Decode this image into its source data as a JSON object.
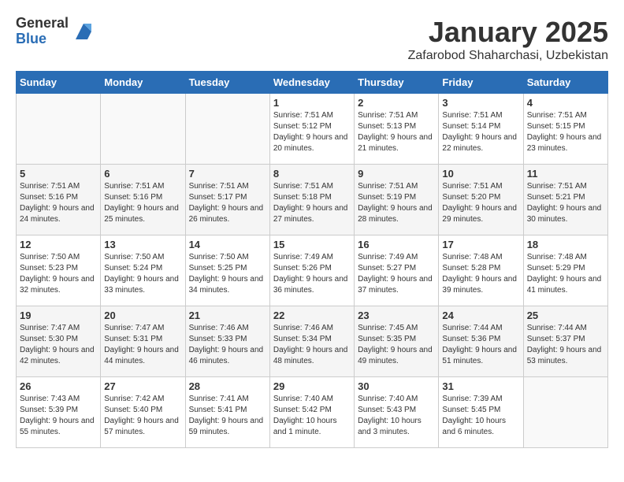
{
  "header": {
    "logo_general": "General",
    "logo_blue": "Blue",
    "month_title": "January 2025",
    "location": "Zafarobod Shaharchasi, Uzbekistan"
  },
  "days_of_week": [
    "Sunday",
    "Monday",
    "Tuesday",
    "Wednesday",
    "Thursday",
    "Friday",
    "Saturday"
  ],
  "weeks": [
    [
      {
        "day": "",
        "sunrise": "",
        "sunset": "",
        "daylight": ""
      },
      {
        "day": "",
        "sunrise": "",
        "sunset": "",
        "daylight": ""
      },
      {
        "day": "",
        "sunrise": "",
        "sunset": "",
        "daylight": ""
      },
      {
        "day": "1",
        "sunrise": "7:51 AM",
        "sunset": "5:12 PM",
        "daylight": "9 hours and 20 minutes."
      },
      {
        "day": "2",
        "sunrise": "7:51 AM",
        "sunset": "5:13 PM",
        "daylight": "9 hours and 21 minutes."
      },
      {
        "day": "3",
        "sunrise": "7:51 AM",
        "sunset": "5:14 PM",
        "daylight": "9 hours and 22 minutes."
      },
      {
        "day": "4",
        "sunrise": "7:51 AM",
        "sunset": "5:15 PM",
        "daylight": "9 hours and 23 minutes."
      }
    ],
    [
      {
        "day": "5",
        "sunrise": "7:51 AM",
        "sunset": "5:16 PM",
        "daylight": "9 hours and 24 minutes."
      },
      {
        "day": "6",
        "sunrise": "7:51 AM",
        "sunset": "5:16 PM",
        "daylight": "9 hours and 25 minutes."
      },
      {
        "day": "7",
        "sunrise": "7:51 AM",
        "sunset": "5:17 PM",
        "daylight": "9 hours and 26 minutes."
      },
      {
        "day": "8",
        "sunrise": "7:51 AM",
        "sunset": "5:18 PM",
        "daylight": "9 hours and 27 minutes."
      },
      {
        "day": "9",
        "sunrise": "7:51 AM",
        "sunset": "5:19 PM",
        "daylight": "9 hours and 28 minutes."
      },
      {
        "day": "10",
        "sunrise": "7:51 AM",
        "sunset": "5:20 PM",
        "daylight": "9 hours and 29 minutes."
      },
      {
        "day": "11",
        "sunrise": "7:51 AM",
        "sunset": "5:21 PM",
        "daylight": "9 hours and 30 minutes."
      }
    ],
    [
      {
        "day": "12",
        "sunrise": "7:50 AM",
        "sunset": "5:23 PM",
        "daylight": "9 hours and 32 minutes."
      },
      {
        "day": "13",
        "sunrise": "7:50 AM",
        "sunset": "5:24 PM",
        "daylight": "9 hours and 33 minutes."
      },
      {
        "day": "14",
        "sunrise": "7:50 AM",
        "sunset": "5:25 PM",
        "daylight": "9 hours and 34 minutes."
      },
      {
        "day": "15",
        "sunrise": "7:49 AM",
        "sunset": "5:26 PM",
        "daylight": "9 hours and 36 minutes."
      },
      {
        "day": "16",
        "sunrise": "7:49 AM",
        "sunset": "5:27 PM",
        "daylight": "9 hours and 37 minutes."
      },
      {
        "day": "17",
        "sunrise": "7:48 AM",
        "sunset": "5:28 PM",
        "daylight": "9 hours and 39 minutes."
      },
      {
        "day": "18",
        "sunrise": "7:48 AM",
        "sunset": "5:29 PM",
        "daylight": "9 hours and 41 minutes."
      }
    ],
    [
      {
        "day": "19",
        "sunrise": "7:47 AM",
        "sunset": "5:30 PM",
        "daylight": "9 hours and 42 minutes."
      },
      {
        "day": "20",
        "sunrise": "7:47 AM",
        "sunset": "5:31 PM",
        "daylight": "9 hours and 44 minutes."
      },
      {
        "day": "21",
        "sunrise": "7:46 AM",
        "sunset": "5:33 PM",
        "daylight": "9 hours and 46 minutes."
      },
      {
        "day": "22",
        "sunrise": "7:46 AM",
        "sunset": "5:34 PM",
        "daylight": "9 hours and 48 minutes."
      },
      {
        "day": "23",
        "sunrise": "7:45 AM",
        "sunset": "5:35 PM",
        "daylight": "9 hours and 49 minutes."
      },
      {
        "day": "24",
        "sunrise": "7:44 AM",
        "sunset": "5:36 PM",
        "daylight": "9 hours and 51 minutes."
      },
      {
        "day": "25",
        "sunrise": "7:44 AM",
        "sunset": "5:37 PM",
        "daylight": "9 hours and 53 minutes."
      }
    ],
    [
      {
        "day": "26",
        "sunrise": "7:43 AM",
        "sunset": "5:39 PM",
        "daylight": "9 hours and 55 minutes."
      },
      {
        "day": "27",
        "sunrise": "7:42 AM",
        "sunset": "5:40 PM",
        "daylight": "9 hours and 57 minutes."
      },
      {
        "day": "28",
        "sunrise": "7:41 AM",
        "sunset": "5:41 PM",
        "daylight": "9 hours and 59 minutes."
      },
      {
        "day": "29",
        "sunrise": "7:40 AM",
        "sunset": "5:42 PM",
        "daylight": "10 hours and 1 minute."
      },
      {
        "day": "30",
        "sunrise": "7:40 AM",
        "sunset": "5:43 PM",
        "daylight": "10 hours and 3 minutes."
      },
      {
        "day": "31",
        "sunrise": "7:39 AM",
        "sunset": "5:45 PM",
        "daylight": "10 hours and 6 minutes."
      },
      {
        "day": "",
        "sunrise": "",
        "sunset": "",
        "daylight": ""
      }
    ]
  ]
}
